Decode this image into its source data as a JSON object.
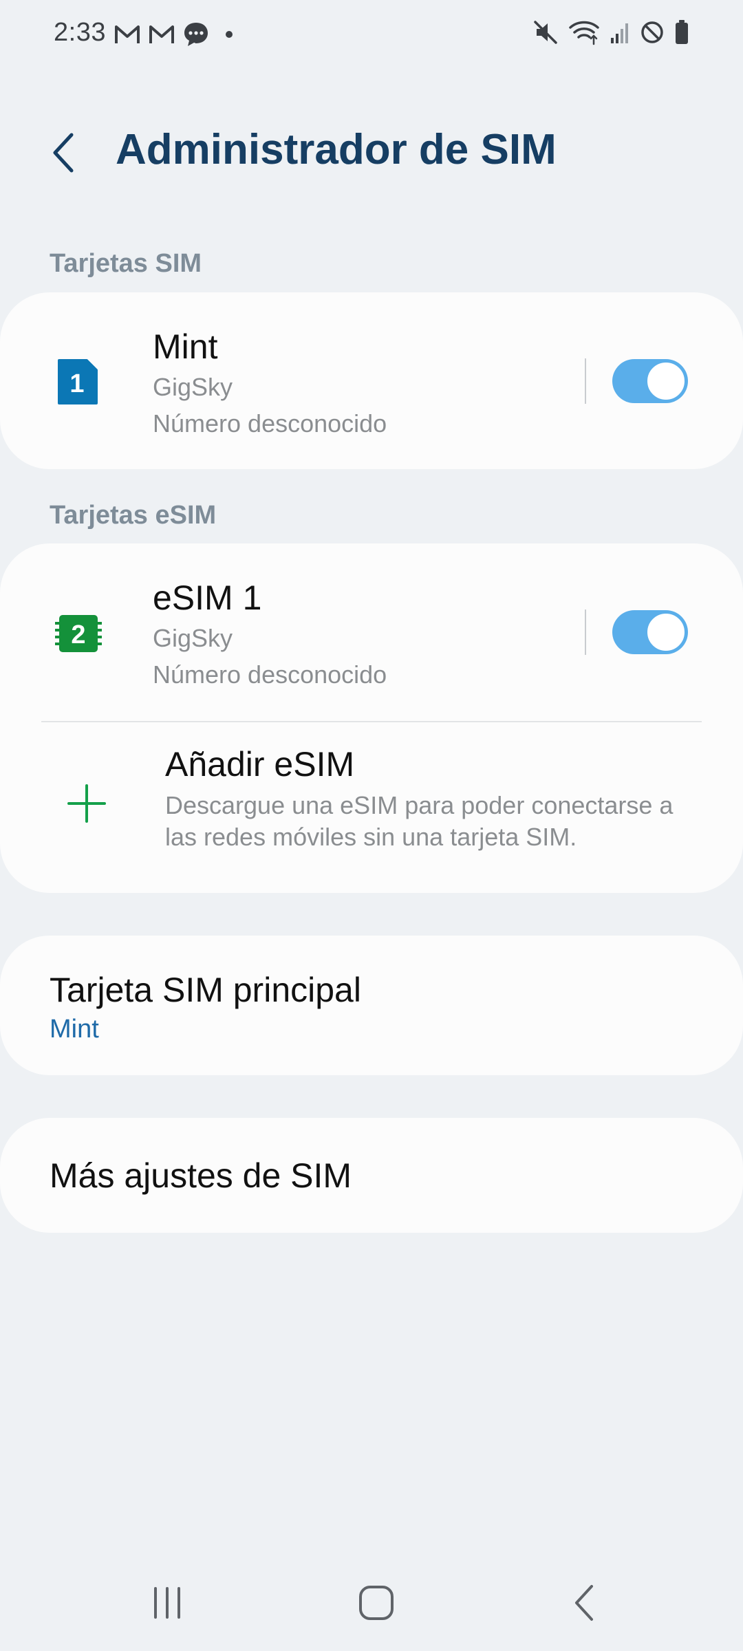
{
  "status_bar": {
    "time": "2:33"
  },
  "header": {
    "title": "Administrador de SIM"
  },
  "sections": {
    "sim_cards": "Tarjetas SIM",
    "esim_cards": "Tarjetas eSIM"
  },
  "sim1": {
    "badge": "1",
    "name": "Mint",
    "carrier": "GigSky",
    "number": "Número desconocido",
    "enabled": true
  },
  "esim1": {
    "badge": "2",
    "name": "eSIM 1",
    "carrier": "GigSky",
    "number": "Número desconocido",
    "enabled": true
  },
  "add_esim": {
    "title": "Añadir eSIM",
    "description": "Descargue una eSIM para poder conectarse a las redes móviles sin una tarjeta SIM."
  },
  "primary_sim": {
    "title": "Tarjeta SIM principal",
    "value": "Mint"
  },
  "more_settings": {
    "title": "Más ajustes de SIM"
  },
  "colors": {
    "accent": "#163e63",
    "toggle_on": "#5aaeea",
    "sim1_icon": "#0b77b5",
    "esim_icon": "#14913a",
    "link": "#1e6aa8"
  },
  "icons": {
    "back": "back-arrow-icon",
    "add": "plus-icon",
    "nav_recents": "recents-icon",
    "nav_home": "home-icon",
    "nav_back": "nav-back-icon"
  }
}
